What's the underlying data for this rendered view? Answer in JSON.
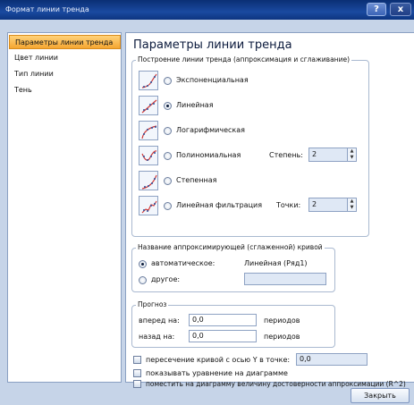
{
  "window": {
    "title": "Формат линии тренда",
    "help_label": "?",
    "close_label": "x"
  },
  "sidebar": {
    "items": [
      {
        "label": "Параметры линии тренда",
        "selected": true
      },
      {
        "label": "Цвет линии",
        "selected": false
      },
      {
        "label": "Тип линии",
        "selected": false
      },
      {
        "label": "Тень",
        "selected": false
      }
    ]
  },
  "panel": {
    "title": "Параметры линии тренда",
    "build_group": {
      "legend": "Построение линии тренда (аппроксимация и сглаживание)",
      "options": [
        {
          "label": "Экспоненциальная",
          "icon": "exponential-trend-icon",
          "selected": false
        },
        {
          "label": "Линейная",
          "icon": "linear-trend-icon",
          "selected": true
        },
        {
          "label": "Логарифмическая",
          "icon": "logarithmic-trend-icon",
          "selected": false
        },
        {
          "label": "Полиномиальная",
          "icon": "polynomial-trend-icon",
          "selected": false
        },
        {
          "label": "Степенная",
          "icon": "power-trend-icon",
          "selected": false
        },
        {
          "label": "Линейная фильтрация",
          "icon": "moving-average-trend-icon",
          "selected": false
        }
      ],
      "degree_label": "Степень:",
      "degree_value": "2",
      "points_label": "Точки:",
      "points_value": "2"
    },
    "name_group": {
      "legend": "Название аппроксимирующей (сглаженной) кривой",
      "auto_label": "автоматическое:",
      "auto_value": "Линейная (Ряд1)",
      "other_label": "другое:",
      "other_value": ""
    },
    "forecast_group": {
      "legend": "Прогноз",
      "forward_label": "вперед на:",
      "forward_value": "0,0",
      "forward_unit": "периодов",
      "backward_label": "назад на:",
      "backward_value": "0,0",
      "backward_unit": "периодов"
    },
    "intercept_label": "пересечение кривой с осью Y в точке:",
    "intercept_value": "0,0",
    "show_equation_label": "показывать уравнение на диаграмме",
    "show_r2_label": "поместить на диаграмму величину достоверности аппроксимации (R^2)"
  },
  "footer": {
    "close_label": "Закрыть"
  },
  "colors": {
    "accent_selected": "#f5a631",
    "titlebar": "#1a4aa0",
    "panel_bg": "#ffffff"
  }
}
